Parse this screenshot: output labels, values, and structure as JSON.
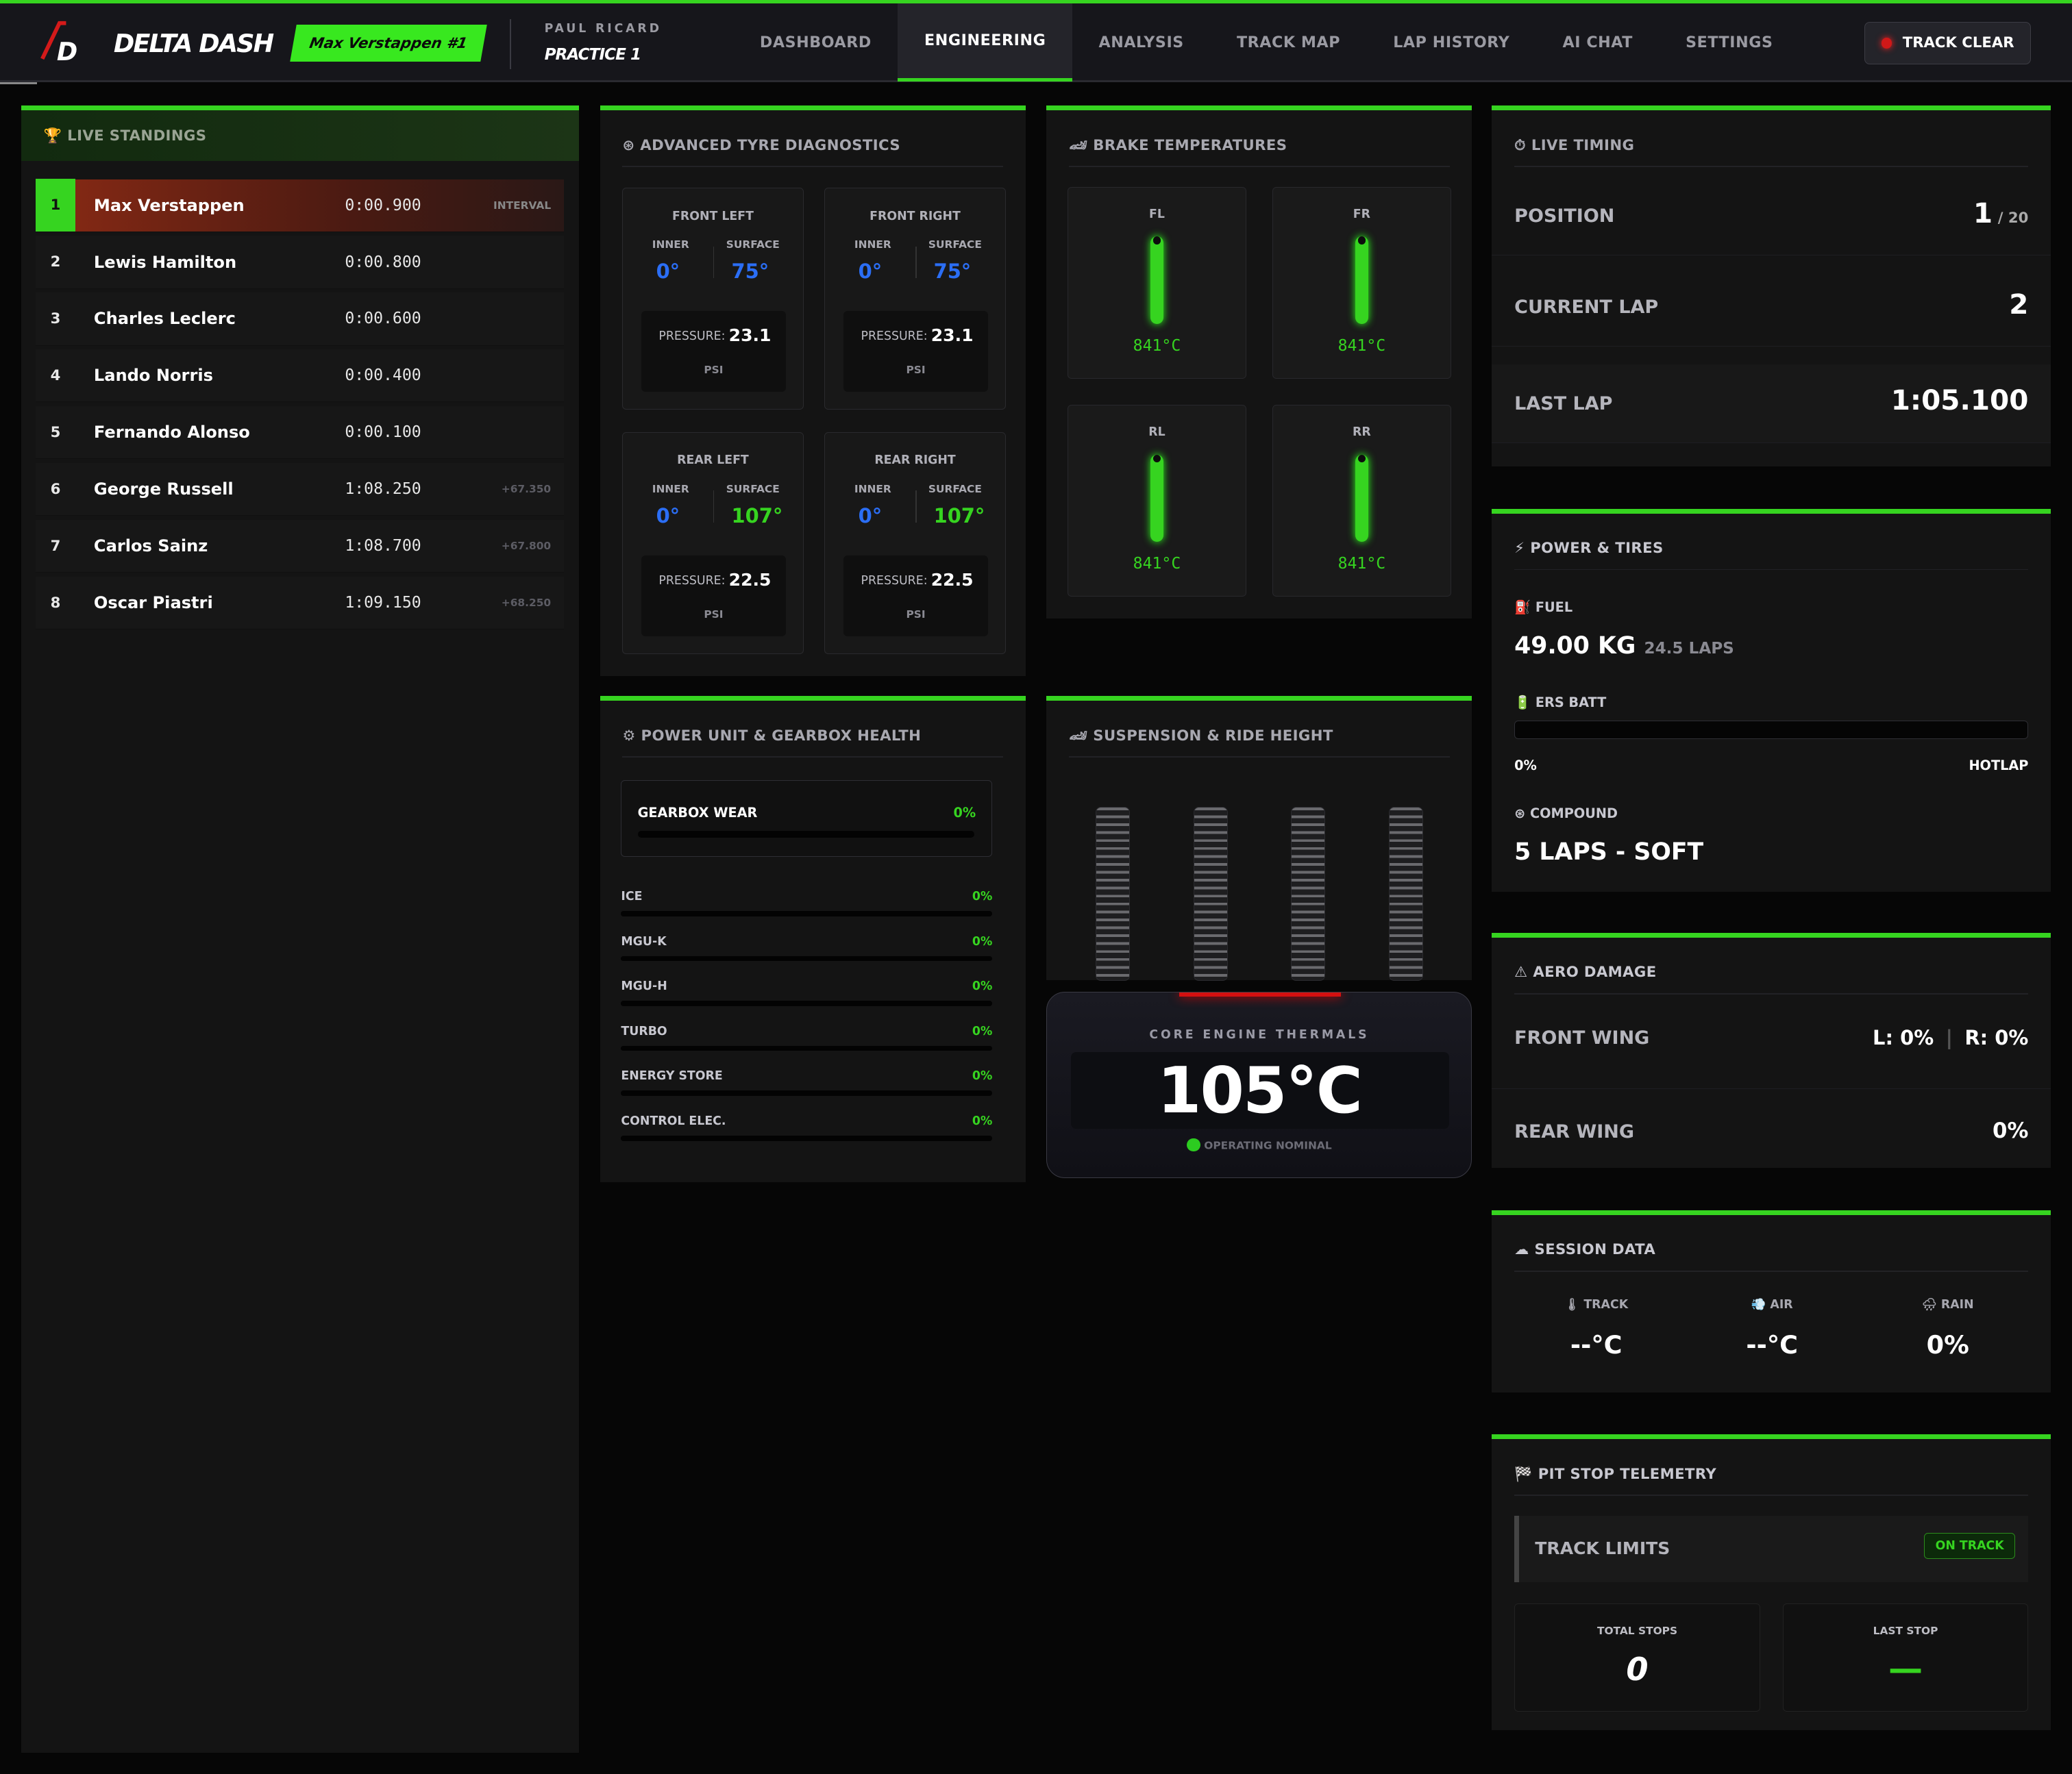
{
  "header": {
    "brand": "DELTA DASH",
    "driver_badge": "Max Verstappen #1",
    "track": "PAUL RICARD",
    "session": "PRACTICE 1",
    "status": "TRACK CLEAR",
    "nav": [
      "DASHBOARD",
      "ENGINEERING",
      "ANALYSIS",
      "TRACK MAP",
      "LAP HISTORY",
      "AI CHAT",
      "SETTINGS"
    ],
    "active_tab": "ENGINEERING"
  },
  "standings": {
    "title": "🏆 LIVE STANDINGS",
    "rows": [
      {
        "pos": "1",
        "name": "Max Verstappen",
        "time": "0:00.900",
        "gap": "INTERVAL"
      },
      {
        "pos": "2",
        "name": "Lewis Hamilton",
        "time": "0:00.800",
        "gap": ""
      },
      {
        "pos": "3",
        "name": "Charles Leclerc",
        "time": "0:00.600",
        "gap": ""
      },
      {
        "pos": "4",
        "name": "Lando Norris",
        "time": "0:00.400",
        "gap": ""
      },
      {
        "pos": "5",
        "name": "Fernando Alonso",
        "time": "0:00.100",
        "gap": ""
      },
      {
        "pos": "6",
        "name": "George Russell",
        "time": "1:08.250",
        "gap": "+67.350"
      },
      {
        "pos": "7",
        "name": "Carlos Sainz",
        "time": "1:08.700",
        "gap": "+67.800"
      },
      {
        "pos": "8",
        "name": "Oscar Piastri",
        "time": "1:09.150",
        "gap": "+68.250"
      }
    ]
  },
  "tyres": {
    "title": "⊛ ADVANCED TYRE DIAGNOSTICS",
    "inner_label": "INNER",
    "surface_label": "SURFACE",
    "pressure_label": "PRESSURE:",
    "pressure_unit": "PSI",
    "cards": [
      {
        "name": "FRONT LEFT",
        "inner": "0°",
        "surface": "75°",
        "surface_color": "#2b6ef5",
        "pressure": "23.1"
      },
      {
        "name": "FRONT RIGHT",
        "inner": "0°",
        "surface": "75°",
        "surface_color": "#2b6ef5",
        "pressure": "23.1"
      },
      {
        "name": "REAR LEFT",
        "inner": "0°",
        "surface": "107°",
        "surface_color": "#36d420",
        "pressure": "22.5"
      },
      {
        "name": "REAR RIGHT",
        "inner": "0°",
        "surface": "107°",
        "surface_color": "#36d420",
        "pressure": "22.5"
      }
    ]
  },
  "brakes": {
    "title": "🏎 BRAKE TEMPERATURES",
    "items": [
      {
        "name": "FL",
        "temp": "841°C"
      },
      {
        "name": "FR",
        "temp": "841°C"
      },
      {
        "name": "RL",
        "temp": "841°C"
      },
      {
        "name": "RR",
        "temp": "841°C"
      }
    ]
  },
  "timing": {
    "title": "⏱ LIVE TIMING",
    "position_label": "POSITION",
    "position": "1",
    "position_total": "/ 20",
    "lap_label": "CURRENT LAP",
    "lap": "2",
    "last_label": "LAST LAP",
    "last": "1:05.100"
  },
  "power": {
    "title": "⚡ POWER & TIRES",
    "fuel_label": "⛽ FUEL",
    "fuel": "49.00 KG",
    "fuel_laps": "24.5 LAPS",
    "ers_label": "🔋 ERS BATT",
    "ers_pct": "0%",
    "ers_mode": "HOTLAP",
    "compound_label": "⊛ COMPOUND",
    "compound": "5 LAPS - SOFT"
  },
  "pu": {
    "title": "⚙ POWER UNIT & GEARBOX HEALTH",
    "gearbox_label": "GEARBOX WEAR",
    "gearbox": "0%",
    "components": [
      {
        "name": "ICE",
        "value": "0%"
      },
      {
        "name": "MGU-K",
        "value": "0%"
      },
      {
        "name": "MGU-H",
        "value": "0%"
      },
      {
        "name": "TURBO",
        "value": "0%"
      },
      {
        "name": "ENERGY STORE",
        "value": "0%"
      },
      {
        "name": "CONTROL ELEC.",
        "value": "0%"
      }
    ]
  },
  "suspension": {
    "title": "🏎 SUSPENSION & RIDE HEIGHT"
  },
  "engine": {
    "title": "CORE ENGINE THERMALS",
    "temp": "105°C",
    "status": "OPERATING NOMINAL"
  },
  "aero": {
    "title": "⚠ AERO DAMAGE",
    "front_label": "FRONT WING",
    "front_l": "L: 0%",
    "front_r": "R: 0%",
    "rear_label": "REAR WING",
    "rear": "0%"
  },
  "session_data": {
    "title": "☁ SESSION DATA",
    "track_label": "🌡 TRACK",
    "track": "--°C",
    "air_label": "💨 AIR",
    "air": "--°C",
    "rain_label": "🌧 RAIN",
    "rain": "0%"
  },
  "pit": {
    "title": "🏁 PIT STOP TELEMETRY",
    "limits_label": "TRACK LIMITS",
    "limits_status": "ON TRACK",
    "stops_label": "TOTAL STOPS",
    "stops": "0",
    "last_label": "LAST STOP",
    "last": "—"
  },
  "colors": {
    "accent": "#36d420",
    "blue": "#2b6ef5",
    "leader_bg": "#8a2a14"
  }
}
